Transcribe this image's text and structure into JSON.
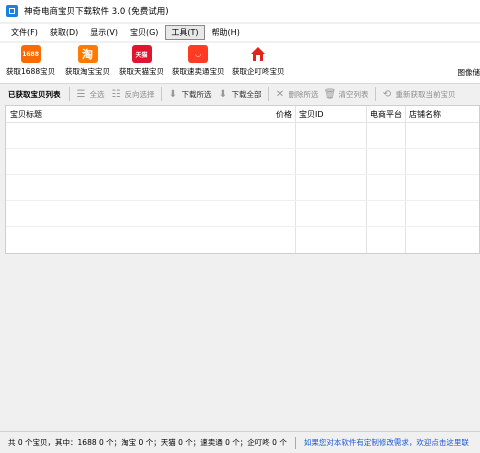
{
  "window": {
    "title": "神奇电商宝贝下载软件 3.0 (免费试用)"
  },
  "menu": [
    {
      "label": "文件(F)",
      "active": false
    },
    {
      "label": "获取(D)",
      "active": false
    },
    {
      "label": "显示(V)",
      "active": false
    },
    {
      "label": "宝贝(G)",
      "active": false
    },
    {
      "label": "工具(T)",
      "active": true
    },
    {
      "label": "帮助(H)",
      "active": false
    }
  ],
  "toolbar": {
    "get_1688": {
      "label": "获取1688宝贝",
      "icon_text": "1688"
    },
    "get_taobao": {
      "label": "获取淘宝宝贝",
      "icon_text": "淘"
    },
    "get_tmall": {
      "label": "获取天猫宝贝",
      "icon_text": "天猫"
    },
    "get_aliexpress": {
      "label": "获取速卖通宝贝",
      "icon_text": "◡"
    },
    "get_qiding": {
      "label": "获取企叮咚宝贝"
    },
    "image_download": {
      "label": "图像储"
    }
  },
  "list_toolbar": {
    "title": "已获取宝贝列表",
    "select_all": "全选",
    "invert": "反向选择",
    "download_selected": "下载所选",
    "download_all": "下载全部",
    "delete_selected": "删除所选",
    "clear_list": "清空列表",
    "refetch": "重新获取当前宝贝"
  },
  "table": {
    "columns": [
      "宝贝标题",
      "价格",
      "宝贝ID",
      "电商平台",
      "店铺名称"
    ]
  },
  "status": {
    "summary": "共 0 个宝贝，其中：1688 0 个；淘宝 0 个；天猫 0 个；速卖通 0 个；企叮咚 0 个",
    "custom_link": "如果您对本软件有定制修改需求，欢迎点击这里联"
  },
  "colors": {
    "link": "#1a58d4",
    "brand_orange": "#ff6a00",
    "tmall_red": "#e0152f"
  }
}
